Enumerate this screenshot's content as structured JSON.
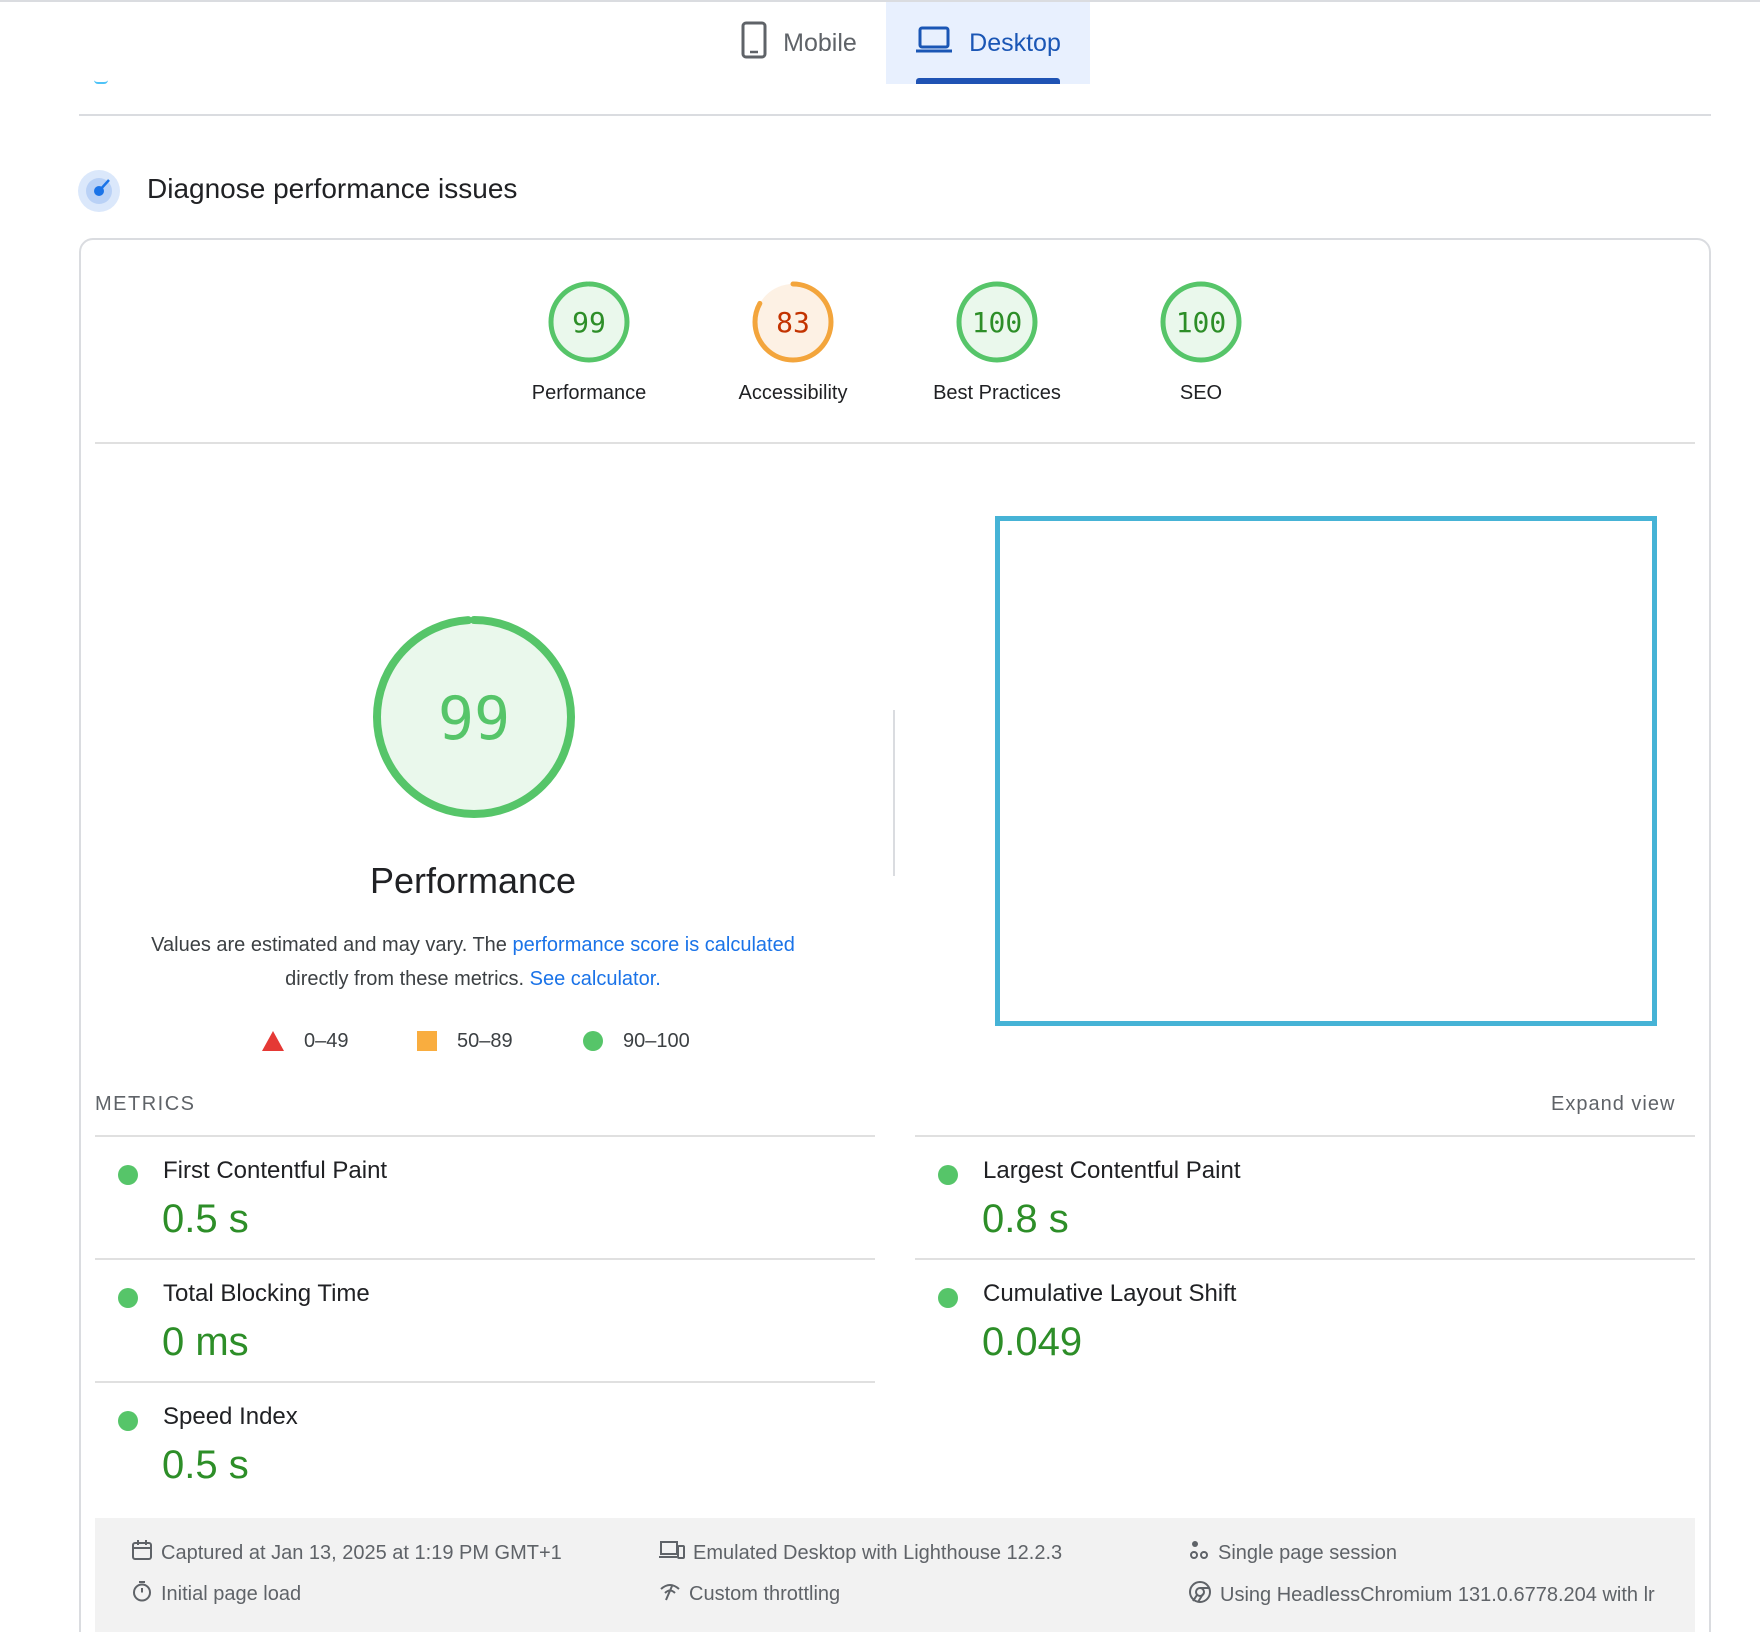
{
  "tabs": [
    {
      "label": "Mobile",
      "active": false
    },
    {
      "label": "Desktop",
      "active": true
    }
  ],
  "section": {
    "title": "Diagnose performance issues"
  },
  "categories": [
    {
      "label": "Performance",
      "score": "99",
      "value": 99,
      "status": "pass"
    },
    {
      "label": "Accessibility",
      "score": "83",
      "value": 83,
      "status": "average"
    },
    {
      "label": "Best Practices",
      "score": "100",
      "value": 100,
      "status": "pass"
    },
    {
      "label": "SEO",
      "score": "100",
      "value": 100,
      "status": "pass"
    }
  ],
  "performance": {
    "score": "99",
    "value": 99,
    "title": "Performance",
    "description_prefix": "Values are estimated and may vary. The",
    "score_link": "performance score is calculated",
    "description_middle": "directly from these metrics.",
    "calculator_link": "See calculator."
  },
  "legend": [
    {
      "range": "0–49",
      "shape": "triangle",
      "color": "#e53935"
    },
    {
      "range": "50–89",
      "shape": "square",
      "color": "#f9ad3f"
    },
    {
      "range": "90–100",
      "shape": "circle",
      "color": "#56c569"
    }
  ],
  "metrics": {
    "heading": "METRICS",
    "expand_label": "Expand view",
    "items": [
      {
        "label": "First Contentful Paint",
        "value": "0.5 s"
      },
      {
        "label": "Largest Contentful Paint",
        "value": "0.8 s"
      },
      {
        "label": "Total Blocking Time",
        "value": "0 ms"
      },
      {
        "label": "Cumulative Layout Shift",
        "value": "0.049"
      },
      {
        "label": "Speed Index",
        "value": "0.5 s"
      }
    ]
  },
  "footer": {
    "captured": "Captured at Jan 13, 2025 at 1:19 PM GMT+1",
    "initial_load": "Initial page load",
    "emulated": "Emulated Desktop with Lighthouse 12.2.3",
    "throttling": "Custom throttling",
    "session": "Single page session",
    "browser": "Using HeadlessChromium 131.0.6778.204 with lr"
  },
  "colors": {
    "pass": "#56c569",
    "pass_text": "#2d8e28",
    "average": "#f3a53c",
    "average_text": "#c33300",
    "accent": "#1a73e8"
  }
}
